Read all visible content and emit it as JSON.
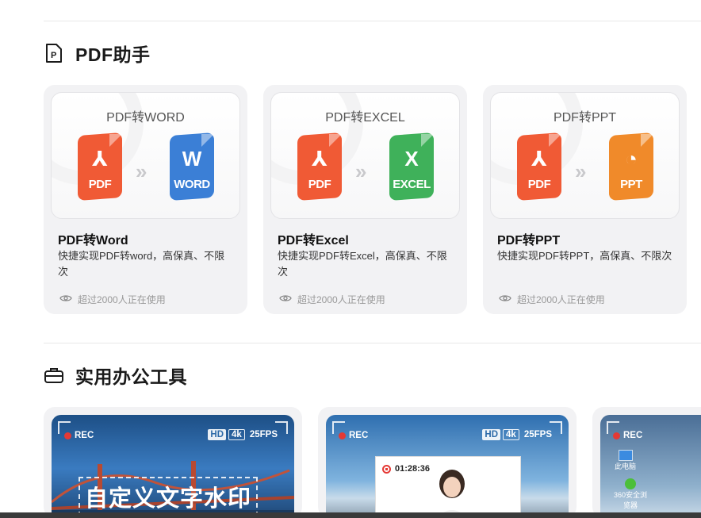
{
  "sections": {
    "pdf": {
      "title": "PDF助手",
      "icon": "pdf-document-icon"
    },
    "tools": {
      "title": "实用办公工具",
      "icon": "briefcase-icon"
    }
  },
  "pdf_cards": [
    {
      "thumb_title": "PDF转WORD",
      "target_label": "WORD",
      "target_glyph": "W",
      "target_color": "#3b7fd6",
      "name": "PDF转Word",
      "desc": "快捷实现PDF转word，高保真、不限次",
      "usage": "超过2000人正在使用"
    },
    {
      "thumb_title": "PDF转EXCEL",
      "target_label": "EXCEL",
      "target_glyph": "X",
      "target_color": "#3fb15a",
      "name": "PDF转Excel",
      "desc": "快捷实现PDF转Excel，高保真、不限次",
      "usage": "超过2000人正在使用"
    },
    {
      "thumb_title": "PDF转PPT",
      "target_label": "PPT",
      "target_glyph": "◔",
      "target_color": "#f08a2a",
      "name": "PDF转PPT",
      "desc": "快捷实现PDF转PPT，高保真、不限次",
      "usage": "超过2000人正在使用"
    }
  ],
  "source_doc": {
    "label": "PDF",
    "glyph": "⅄",
    "color": "#f05a35"
  },
  "arrow_glyph": "»",
  "tool_cards": [
    {
      "rec": "REC",
      "badges": [
        "HD",
        "4k",
        "25FPS"
      ],
      "watermark": "自定义文字水印"
    },
    {
      "rec": "REC",
      "badges": [
        "HD",
        "4k",
        "25FPS"
      ],
      "timer": "01:28:36"
    },
    {
      "rec": "REC",
      "desktop_icons": [
        "此电脑",
        "360安全浏览器"
      ]
    }
  ],
  "colors": {
    "accent_red": "#e53935",
    "card_bg": "#f2f2f4"
  }
}
